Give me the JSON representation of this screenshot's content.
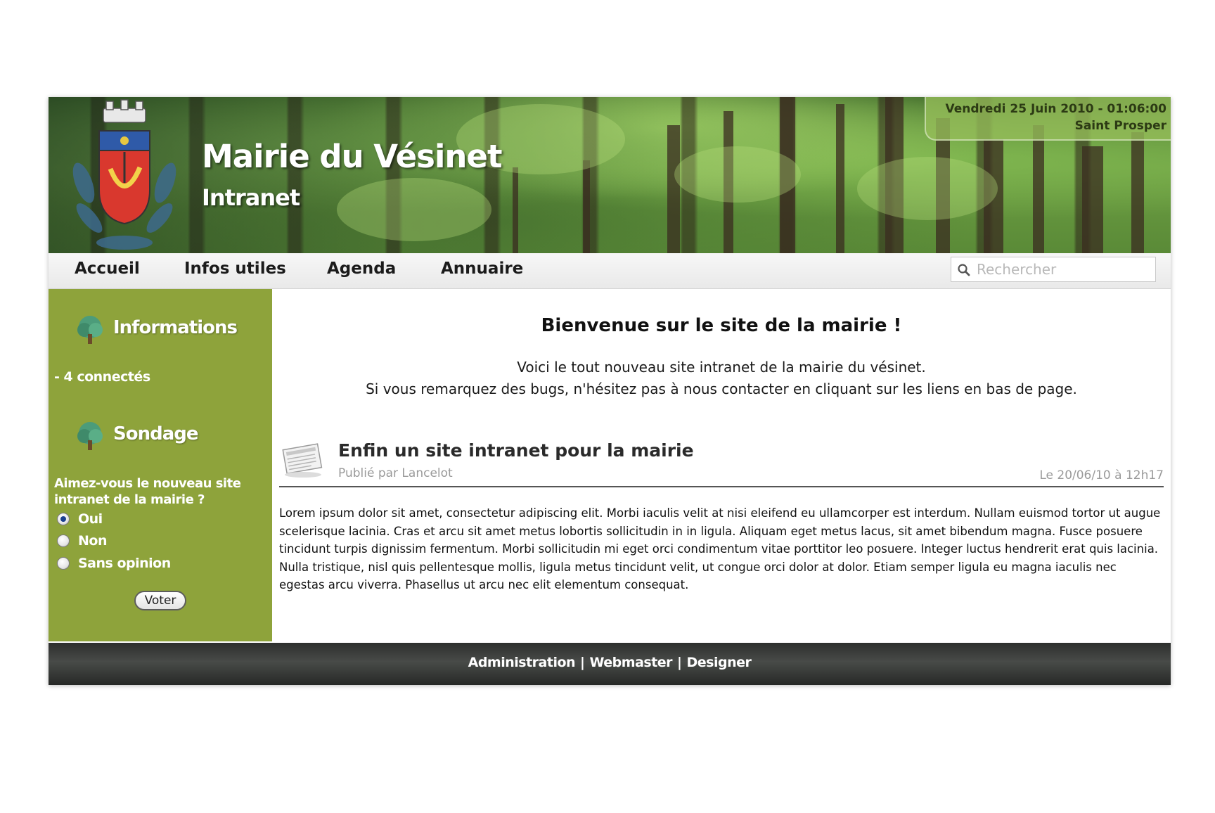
{
  "header": {
    "title": "Mairie du Vésinet",
    "subtitle": "Intranet",
    "datetime": "Vendredi 25 Juin 2010 - 01:06:00",
    "saint": "Saint Prosper"
  },
  "nav": {
    "items": [
      {
        "label": "Accueil"
      },
      {
        "label": "Infos utiles"
      },
      {
        "label": "Agenda"
      },
      {
        "label": "Annuaire"
      }
    ],
    "search_placeholder": "Rechercher"
  },
  "sidebar": {
    "info_title": "Informations",
    "connected": "- 4 connectés",
    "poll_title": "Sondage",
    "poll_question": "Aimez-vous le nouveau site intranet de la mairie ?",
    "poll_options": [
      {
        "label": "Oui",
        "checked": true
      },
      {
        "label": "Non",
        "checked": false
      },
      {
        "label": "Sans opinion",
        "checked": false
      }
    ],
    "vote_label": "Voter"
  },
  "main": {
    "welcome_title": "Bienvenue sur le site de la mairie !",
    "welcome_line1": "Voici le tout nouveau site intranet de la mairie du vésinet.",
    "welcome_line2": "Si vous remarquez des bugs, n'hésitez pas à nous contacter en cliquant sur les liens en bas de page.",
    "article": {
      "title": "Enfin un site intranet pour la mairie",
      "author": "Publié par Lancelot",
      "date": "Le 20/06/10 à 12h17",
      "body": "Lorem ipsum dolor sit amet, consectetur adipiscing elit. Morbi iaculis velit at nisi eleifend eu ullamcorper est interdum. Nullam euismod tortor ut augue scelerisque lacinia. Cras et arcu sit amet metus lobortis sollicitudin in in ligula. Aliquam eget metus lacus, sit amet bibendum magna. Fusce posuere tincidunt turpis dignissim fermentum. Morbi sollicitudin mi eget orci condimentum vitae porttitor leo posuere. Integer luctus hendrerit erat quis lacinia. Nulla tristique, nisl quis pellentesque mollis, ligula metus tincidunt velit, ut congue orci dolor at dolor. Etiam semper ligula eu magna iaculis nec egestas arcu viverra. Phasellus ut arcu nec elit elementum consequat."
    }
  },
  "footer": {
    "links": [
      "Administration",
      "Webmaster",
      "Designer"
    ],
    "separator": "|"
  },
  "colors": {
    "sidebar_green": "#8ea33b",
    "footer_dark": "#2d2f2d",
    "date_box": "#96be5a"
  },
  "icons": [
    "crest-logo",
    "search-icon",
    "tree-icon",
    "newspaper-icon",
    "radio-button"
  ]
}
